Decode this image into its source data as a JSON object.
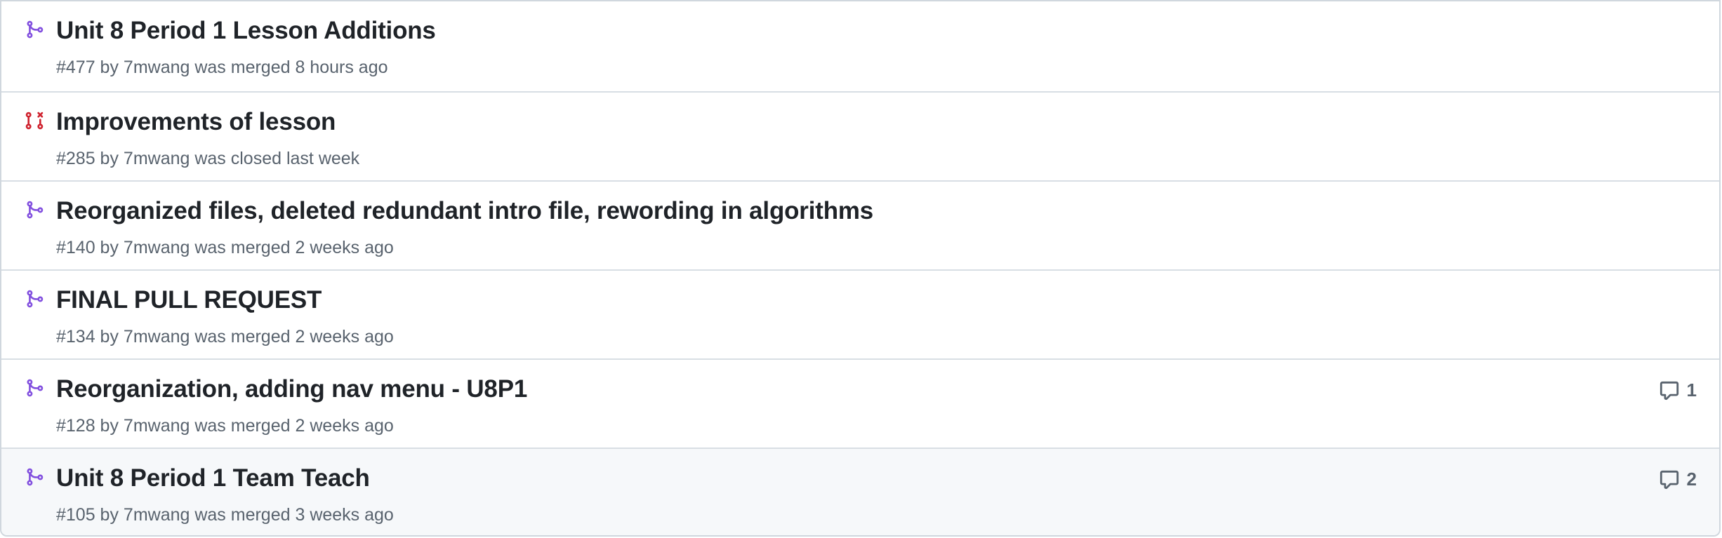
{
  "colors": {
    "merged": "#8250df",
    "closed": "#cf222e",
    "border": "#d0d7de",
    "hover_bg": "#f6f8fa",
    "muted_text": "#59636e"
  },
  "pull_requests": [
    {
      "state": "merged",
      "state_icon": "git-merge-icon",
      "title": "Unit 8 Period 1 Lesson Additions",
      "meta": "#477 by 7mwang was merged 8 hours ago",
      "comments": null
    },
    {
      "state": "closed",
      "state_icon": "git-pull-request-closed-icon",
      "title": "Improvements of lesson",
      "meta": "#285 by 7mwang was closed last week",
      "comments": null
    },
    {
      "state": "merged",
      "state_icon": "git-merge-icon",
      "title": "Reorganized files, deleted redundant intro file, rewording in algorithms",
      "meta": "#140 by 7mwang was merged 2 weeks ago",
      "comments": null
    },
    {
      "state": "merged",
      "state_icon": "git-merge-icon",
      "title": "FINAL PULL REQUEST",
      "meta": "#134 by 7mwang was merged 2 weeks ago",
      "comments": null
    },
    {
      "state": "merged",
      "state_icon": "git-merge-icon",
      "title": "Reorganization, adding nav menu - U8P1",
      "meta": "#128 by 7mwang was merged 2 weeks ago",
      "comments": "1"
    },
    {
      "state": "merged",
      "state_icon": "git-merge-icon",
      "title": "Unit 8 Period 1 Team Teach",
      "meta": "#105 by 7mwang was merged 3 weeks ago",
      "comments": "2"
    }
  ]
}
